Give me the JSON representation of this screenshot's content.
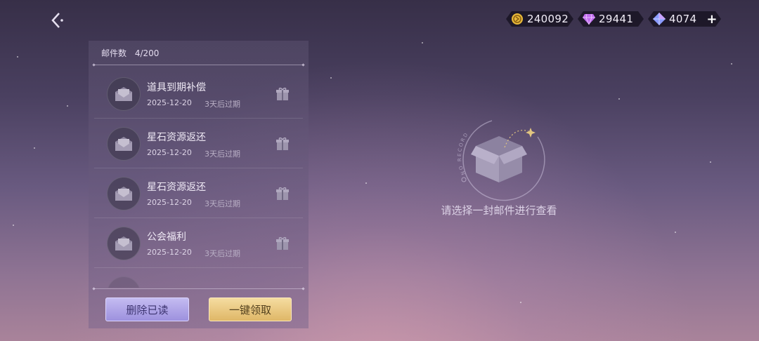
{
  "header": {
    "back_icon": "chevron-left-icon",
    "currencies": [
      {
        "name": "gold-coin",
        "value": "240092",
        "color": "#e8b93a"
      },
      {
        "name": "purple-gem",
        "value": "29441",
        "color": "#c26df0"
      },
      {
        "name": "blue-gem",
        "value": "4074",
        "color": "#7c8dff"
      }
    ],
    "plus_label": "+"
  },
  "mailbox": {
    "count_label": "邮件数",
    "count_value": "4/200",
    "items": [
      {
        "title": "道具到期补偿",
        "date": "2025-12-20",
        "expiry": "3天后过期"
      },
      {
        "title": "星石资源返还",
        "date": "2025-12-20",
        "expiry": "3天后过期"
      },
      {
        "title": "星石资源返还",
        "date": "2025-12-20",
        "expiry": "3天后过期"
      },
      {
        "title": "公会福利",
        "date": "2025-12-20",
        "expiry": "3天后过期"
      }
    ],
    "delete_read_label": "删除已读",
    "claim_all_label": "一键领取"
  },
  "empty_state": {
    "badge_text": "NO RECORD",
    "message": "请选择一封邮件进行查看"
  }
}
